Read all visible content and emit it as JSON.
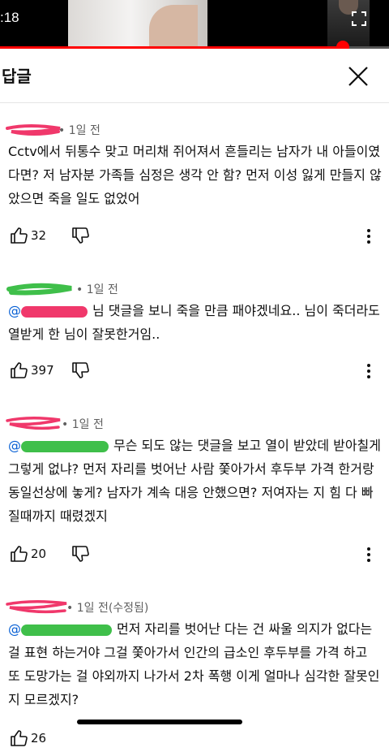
{
  "status": {
    "time": ":18"
  },
  "video": {
    "progress": 0.88
  },
  "header": {
    "title": "답글",
    "close_icon": "close-icon"
  },
  "comments": [
    {
      "meta": "• 1일 전",
      "text": "Cctv에서 뒤통수 맞고 머리채 쥐어져서 흔들리는 남자가 내 아들이였다면? 저 남자분 가족들 심정은 생각 안 함? 먼저 이성 잃게 만들지 않았으면 죽을 일도 없었어",
      "likes": "32"
    },
    {
      "meta": "• 1일 전",
      "mention": "@",
      "text": "님 댓글을 보니 죽을 만큼 패야겠네요.. 님이 죽더라도 열받게 한 님이 잘못한거임..",
      "likes": "397"
    },
    {
      "meta": "• 1일 전",
      "mention": "@",
      "text": "무슨 되도 않는 댓글을 보고 열이 받았데 받아칠게 그렇게 없냐? 먼저 자리를 벗어난 사람 쫓아가서 후두부 가격 한거랑 동일선상에 놓게? 남자가 계속 대응 안했으면? 저여자는 지 힘 다 빠질때까지 때렸겠지",
      "likes": "20"
    },
    {
      "meta": "• 1일 전(수정됨)",
      "mention": "@",
      "text": "먼저 자리를 벗어난 다는 건 싸울 의지가 없다는걸 표현 하는거야 그걸 쫓아가서 인간의 급소인 후두부를 가격 하고 또 도망가는 걸 야외까지 나가서 2차 폭행 이게 얼마나 심각한 잘못인지 모르겠지?",
      "likes": "26"
    }
  ],
  "colors": {
    "accent": "#ff0000",
    "mention": "#065fd4",
    "scribble_pink": "#f0386b",
    "scribble_green": "#3fbf4a"
  }
}
